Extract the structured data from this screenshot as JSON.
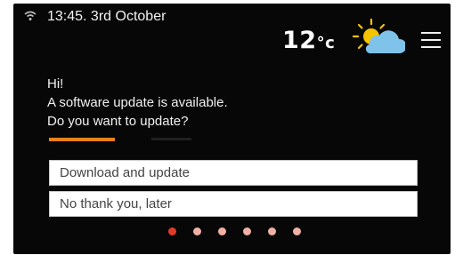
{
  "status_bar": {
    "datetime": "13:45. 3rd October"
  },
  "weather": {
    "temp_value": "12",
    "temp_unit": "°c",
    "icon": "partly-cloudy-icon"
  },
  "menu": {
    "icon": "hamburger-menu-icon"
  },
  "message": {
    "greeting": "Hi!",
    "line1": "A software update is available.",
    "line2": "Do you want to update?"
  },
  "options": {
    "download": "Download and update",
    "later": "No thank you, later"
  },
  "pager": {
    "total": 6,
    "active_index": 0
  },
  "colors": {
    "screen_bg": "#070707",
    "accent": "#e8821c",
    "active_dot": "#e23a28",
    "inactive_dot": "#f1b0a6"
  }
}
